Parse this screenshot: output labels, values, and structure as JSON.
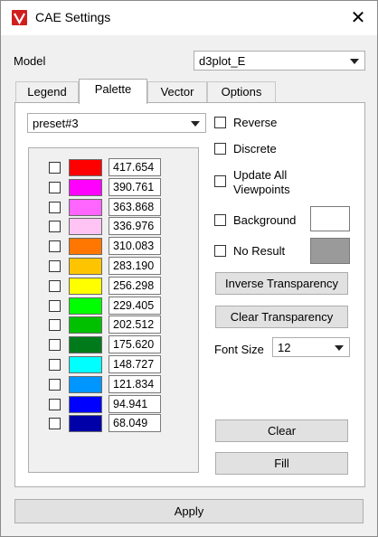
{
  "window": {
    "title": "CAE Settings",
    "close_glyph": "✕",
    "app_icon": "app-logo-icon"
  },
  "model": {
    "label": "Model",
    "value": "d3plot_E"
  },
  "tabs": [
    {
      "label": "Legend",
      "active": false
    },
    {
      "label": "Palette",
      "active": true
    },
    {
      "label": "Vector",
      "active": false
    },
    {
      "label": "Options",
      "active": false
    }
  ],
  "palette": {
    "preset": "preset#3",
    "entries": [
      {
        "value": "417.654",
        "color": "#ff0000",
        "checked": false
      },
      {
        "value": "390.761",
        "color": "#ff00ff",
        "checked": false
      },
      {
        "value": "363.868",
        "color": "#ff66ff",
        "checked": false
      },
      {
        "value": "336.976",
        "color": "#ffc4f3",
        "checked": false
      },
      {
        "value": "310.083",
        "color": "#ff7700",
        "checked": false
      },
      {
        "value": "283.190",
        "color": "#ffc400",
        "checked": false
      },
      {
        "value": "256.298",
        "color": "#ffff00",
        "checked": false
      },
      {
        "value": "229.405",
        "color": "#00ff00",
        "checked": false
      },
      {
        "value": "202.512",
        "color": "#00c000",
        "checked": false
      },
      {
        "value": "175.620",
        "color": "#007a1a",
        "checked": false
      },
      {
        "value": "148.727",
        "color": "#00ffff",
        "checked": false
      },
      {
        "value": "121.834",
        "color": "#0096ff",
        "checked": false
      },
      {
        "value": "94.941",
        "color": "#0000ff",
        "checked": false
      },
      {
        "value": "68.049",
        "color": "#0000a8",
        "checked": false
      }
    ]
  },
  "options": {
    "reverse": "Reverse",
    "discrete": "Discrete",
    "update_all_line1": "Update All",
    "update_all_line2": "Viewpoints",
    "background": "Background",
    "background_color": "#ffffff",
    "no_result": "No Result",
    "no_result_color": "#9a9a9a"
  },
  "buttons": {
    "inverse_transparency": "Inverse Transparency",
    "clear_transparency": "Clear Transparency",
    "clear": "Clear",
    "fill": "Fill",
    "apply": "Apply"
  },
  "font_size": {
    "label": "Font Size",
    "value": "12"
  }
}
